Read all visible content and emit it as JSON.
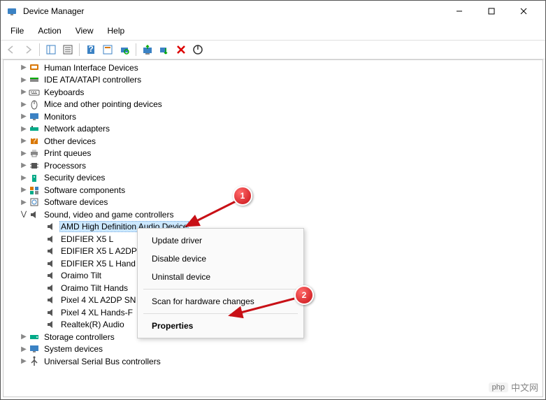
{
  "titlebar": {
    "title": "Device Manager"
  },
  "menubar": {
    "file": "File",
    "action": "Action",
    "view": "View",
    "help": "Help"
  },
  "tree": {
    "hid": "Human Interface Devices",
    "ide": "IDE ATA/ATAPI controllers",
    "keyboards": "Keyboards",
    "mice": "Mice and other pointing devices",
    "monitors": "Monitors",
    "network": "Network adapters",
    "other": "Other devices",
    "printq": "Print queues",
    "processors": "Processors",
    "security": "Security devices",
    "softcomp": "Software components",
    "softdev": "Software devices",
    "sound": "Sound, video and game controllers",
    "sound_items": {
      "amd": "AMD High Definition Audio Device",
      "edifierx5l": "EDIFIER X5 L",
      "edifierx5la2dp": "EDIFIER X5 L A2DP",
      "edifierx5lhand": "EDIFIER X5 L Hand",
      "oraimotilt": "Oraimo Tilt",
      "oraimotilthands": "Oraimo Tilt Hands",
      "pixel4a2dp": "Pixel 4 XL A2DP SN",
      "pixel4hands": "Pixel 4 XL Hands-F",
      "realtek": "Realtek(R) Audio"
    },
    "storage": "Storage controllers",
    "system": "System devices",
    "usb": "Universal Serial Bus controllers"
  },
  "context_menu": {
    "update": "Update driver",
    "disable": "Disable device",
    "uninstall": "Uninstall device",
    "scan": "Scan for hardware changes",
    "properties": "Properties"
  },
  "markers": {
    "one": "1",
    "two": "2"
  },
  "watermark": {
    "box": "php",
    "text": "中文网"
  }
}
